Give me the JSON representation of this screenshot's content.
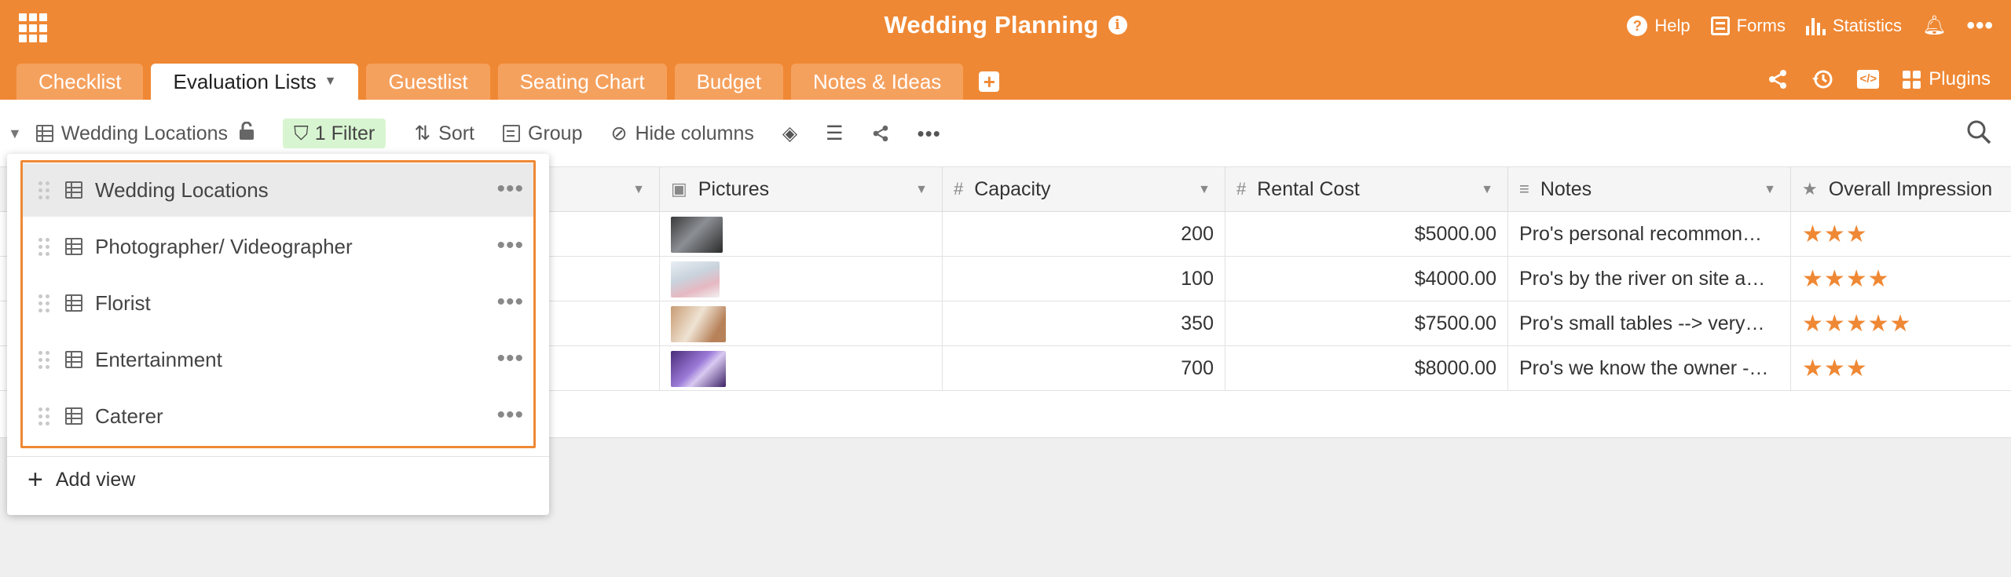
{
  "header": {
    "title": "Wedding Planning",
    "info_icon": "ⓘ",
    "help_label": "Help",
    "forms_label": "Forms",
    "statistics_label": "Statistics",
    "accent_color": "#ef8834"
  },
  "tabs": [
    {
      "label": "Checklist"
    },
    {
      "label": "Evaluation Lists",
      "active": true
    },
    {
      "label": "Guestlist"
    },
    {
      "label": "Seating Chart"
    },
    {
      "label": "Budget"
    },
    {
      "label": "Notes & Ideas"
    }
  ],
  "tab_right": {
    "plugins_label": "Plugins"
  },
  "toolbar": {
    "view_name": "Wedding Locations",
    "filter_label": "1 Filter",
    "sort_label": "Sort",
    "group_label": "Group",
    "hide_columns_label": "Hide columns"
  },
  "columns": [
    {
      "label": ""
    },
    {
      "label": "Pictures"
    },
    {
      "label": "Capacity"
    },
    {
      "label": "Rental Cost"
    },
    {
      "label": "Notes"
    },
    {
      "label": "Overall Impression"
    }
  ],
  "rows": [
    {
      "capacity": "200",
      "rental_cost": "$5000.00",
      "notes": "Pro's personal recommon…",
      "impression": "★★★",
      "rating": 3
    },
    {
      "capacity": "100",
      "rental_cost": "$4000.00",
      "notes": "Pro's by the river on site a…",
      "impression": "★★★★",
      "rating": 4
    },
    {
      "capacity": "350",
      "rental_cost": "$7500.00",
      "notes": "Pro's small tables --> very…",
      "impression": "★★★★★",
      "rating": 5
    },
    {
      "capacity": "700",
      "rental_cost": "$8000.00",
      "notes": "Pro's we know the owner -…",
      "impression": "★★★",
      "rating": 3
    }
  ],
  "views": [
    {
      "label": "Wedding Locations",
      "selected": true
    },
    {
      "label": "Photographer/ Videographer"
    },
    {
      "label": "Florist"
    },
    {
      "label": "Entertainment"
    },
    {
      "label": "Caterer"
    }
  ],
  "add_view_label": "Add view"
}
